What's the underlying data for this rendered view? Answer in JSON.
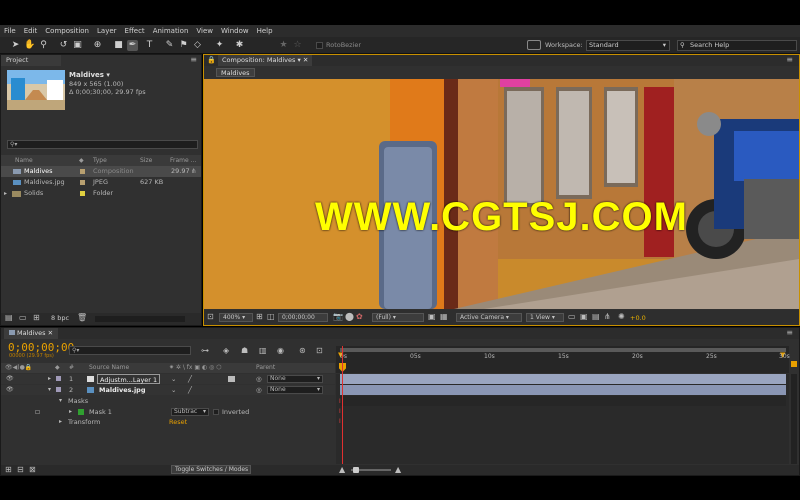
{
  "menu": [
    "File",
    "Edit",
    "Composition",
    "Layer",
    "Effect",
    "Animation",
    "View",
    "Window",
    "Help"
  ],
  "toolbar": {
    "tool_option": "RotoBezier",
    "workspace_label": "Workspace:",
    "workspace_value": "Standard",
    "search_placeholder": "Search Help"
  },
  "project": {
    "tab": "Project",
    "item_name": "Maldives ▾",
    "item_size": "849 x 565 (1.00)",
    "item_duration": "Δ 0;00;30;00, 29.97 fps",
    "search_value": "⚲▾",
    "headers": {
      "name": "Name",
      "type": "Type",
      "size": "Size",
      "frame": "Frame ..."
    },
    "items": [
      {
        "name": "Maldives",
        "type": "Composition",
        "size": "",
        "frame": "29.97",
        "color": "#b8a070"
      },
      {
        "name": "Maldives.jpg",
        "type": "JPEG",
        "size": "627 KB",
        "frame": "",
        "color": "#b8a070"
      },
      {
        "name": "Solids",
        "type": "Folder",
        "size": "",
        "frame": "",
        "color": "#e0d040"
      }
    ],
    "bpc": "8 bpc"
  },
  "comp": {
    "tab": "Composition: Maldives",
    "subtab": "Maldives",
    "zoom": "400%",
    "timecode": "0;00;00;00",
    "resolution": "(Full)",
    "camera": "Active Camera",
    "views": "1 View",
    "exposure": "+0.0"
  },
  "watermark": "WWW.CGTSJ.COM",
  "timeline": {
    "tab": "Maldives",
    "timecode": "0;00;00;00",
    "fps": "00000 (29.97 fps)",
    "search_value": "⚲▾",
    "headers": {
      "num": "#",
      "source": "Source Name",
      "parent": "Parent"
    },
    "ruler": [
      "0s",
      "05s",
      "10s",
      "15s",
      "20s",
      "25s",
      "30s"
    ],
    "layers": [
      {
        "num": "1",
        "name": "Adjustm...Layer 1",
        "parent": "None"
      },
      {
        "num": "2",
        "name": "Maldives.jpg",
        "parent": "None"
      }
    ],
    "masks_label": "Masks",
    "mask_name": "Mask 1",
    "mask_mode": "Subtrac",
    "mask_inverted": "Inverted",
    "transform_label": "Transform",
    "reset_label": "Reset",
    "toggle_label": "Toggle Switches / Modes"
  },
  "colors": {
    "accent": "#e8a000",
    "bar": "#9aa5c0",
    "watermark": "#ffff00"
  }
}
